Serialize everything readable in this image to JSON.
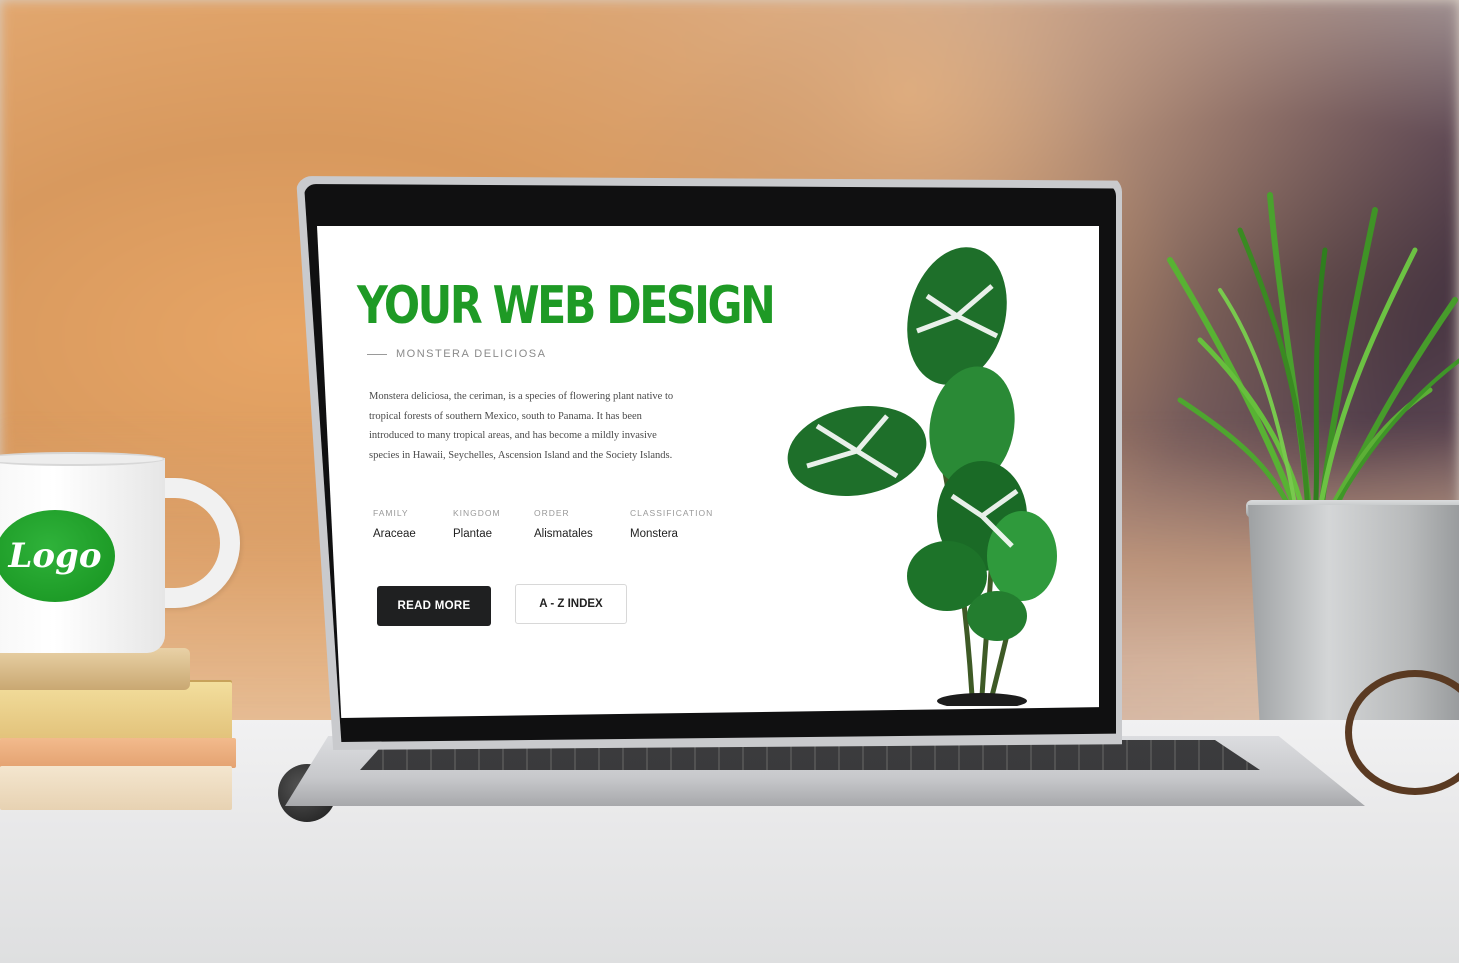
{
  "screen": {
    "hero_title": "YOUR WEB DESIGN",
    "subtitle": "MONSTERA DELICIOSA",
    "description": "Monstera deliciosa, the ceriman, is a species of flowering plant native to tropical forests of southern Mexico, south to Panama. It has been introduced to many tropical areas, and has become a mildly invasive species in Hawaii, Seychelles, Ascension Island and the Society Islands.",
    "meta": [
      {
        "label": "FAMILY",
        "value": "Araceae"
      },
      {
        "label": "KINGDOM",
        "value": "Plantae"
      },
      {
        "label": "ORDER",
        "value": "Alismatales"
      },
      {
        "label": "CLASSIFICATION",
        "value": "Monstera"
      }
    ],
    "buttons": {
      "read_more": "READ MORE",
      "az_index": "A - Z INDEX"
    }
  },
  "mug": {
    "logo_text": "Logo"
  },
  "colors": {
    "accent_green": "#1e9a25",
    "button_dark": "#1f2021",
    "logo_green": "#16921f"
  },
  "icons": [
    "monstera-plant-illustration",
    "grass-plant",
    "coffee-mug",
    "eyeglasses",
    "pen"
  ]
}
